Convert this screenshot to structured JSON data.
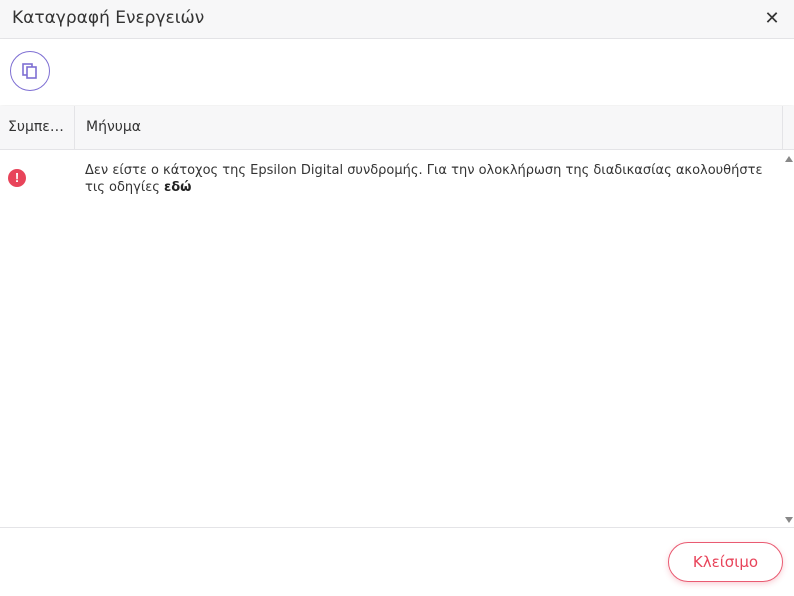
{
  "dialog": {
    "title": "Καταγραφή Ενεργειών",
    "close_glyph": "✕"
  },
  "toolbar": {
    "copy_icon": "copy-icon"
  },
  "grid": {
    "columns": [
      "Συμπε…",
      "Μήνυμα"
    ],
    "rows": [
      {
        "severity": "error",
        "severity_glyph": "!",
        "message": "Δεν είστε ο κάτοχος της Epsilon Digital συνδρομής. Για την ολοκλήρωση της διαδικασίας ακολουθήστε τις οδηγίες ",
        "link_text": "εδώ"
      }
    ]
  },
  "footer": {
    "close_label": "Κλείσιμο"
  },
  "colors": {
    "accent_purple": "#7e6fd3",
    "error_red": "#e8445a"
  }
}
